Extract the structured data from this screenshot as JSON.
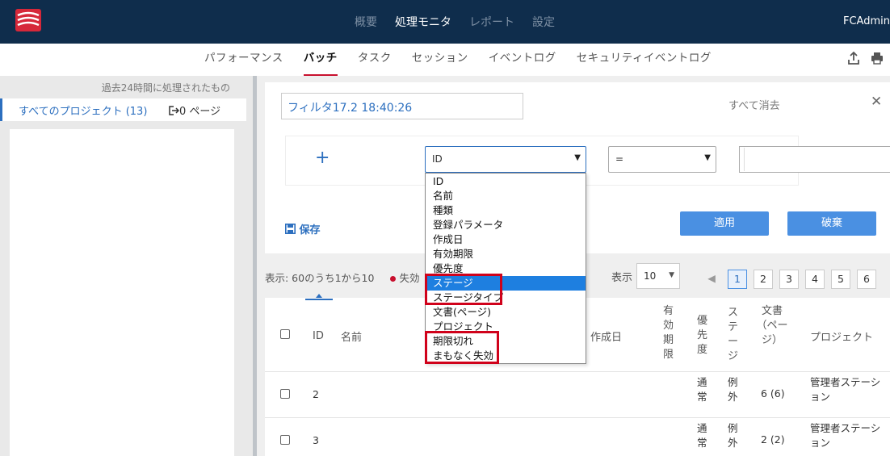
{
  "app": {
    "user": "FCAdmin"
  },
  "topnav": [
    "概要",
    "処理モニタ",
    "レポート",
    "設定"
  ],
  "subnav": [
    "パフォーマンス",
    "バッチ",
    "タスク",
    "セッション",
    "イベントログ",
    "セキュリティイベントログ"
  ],
  "colors": {
    "header": "#0f2d4c",
    "accent": "#2c6fbf",
    "button": "#4a90e2",
    "active_underline": "#c8102e",
    "highlight_box": "#d0021b"
  },
  "left": {
    "caption": "過去24時間に処理されたもの",
    "all_projects": "すべてのプロジェクト (13)",
    "pages": "0 ページ"
  },
  "filter": {
    "name": "フィルタ17.2 18:40:26",
    "clear_all": "すべて消去",
    "field_value": "ID",
    "operator_value": "=",
    "save_label": "保存",
    "apply_label": "適用",
    "discard_label": "破棄",
    "field_options": [
      "ID",
      "名前",
      "種類",
      "登録パラメータ",
      "作成日",
      "有効期限",
      "優先度",
      "ステージ",
      "ステージタイプ",
      "文書(ページ)",
      "プロジェクト",
      "期限切れ",
      "まもなく失効"
    ],
    "selected_option": "ステージ"
  },
  "listing": {
    "summary": "表示: 60のうち1から10",
    "expired_label": "失効",
    "page_size_label": "表示",
    "page_size": "10",
    "pages": [
      "1",
      "2",
      "3",
      "4",
      "5",
      "6"
    ],
    "current_page": "1"
  },
  "table": {
    "headers": {
      "id": "ID",
      "name": "名前",
      "created": "作成日",
      "expires": "有効期限",
      "priority": "優先度",
      "stage": "ステージ",
      "docs": "文書（ページ）",
      "project": "プロジェクト"
    },
    "rows": [
      {
        "id": "2",
        "priority": "通常",
        "stage": "例外",
        "docs": "6 (6)",
        "project": "管理者ステーション"
      },
      {
        "id": "3",
        "priority": "通常",
        "stage": "例外",
        "docs": "2 (2)",
        "project": "管理者ステーション"
      }
    ]
  }
}
